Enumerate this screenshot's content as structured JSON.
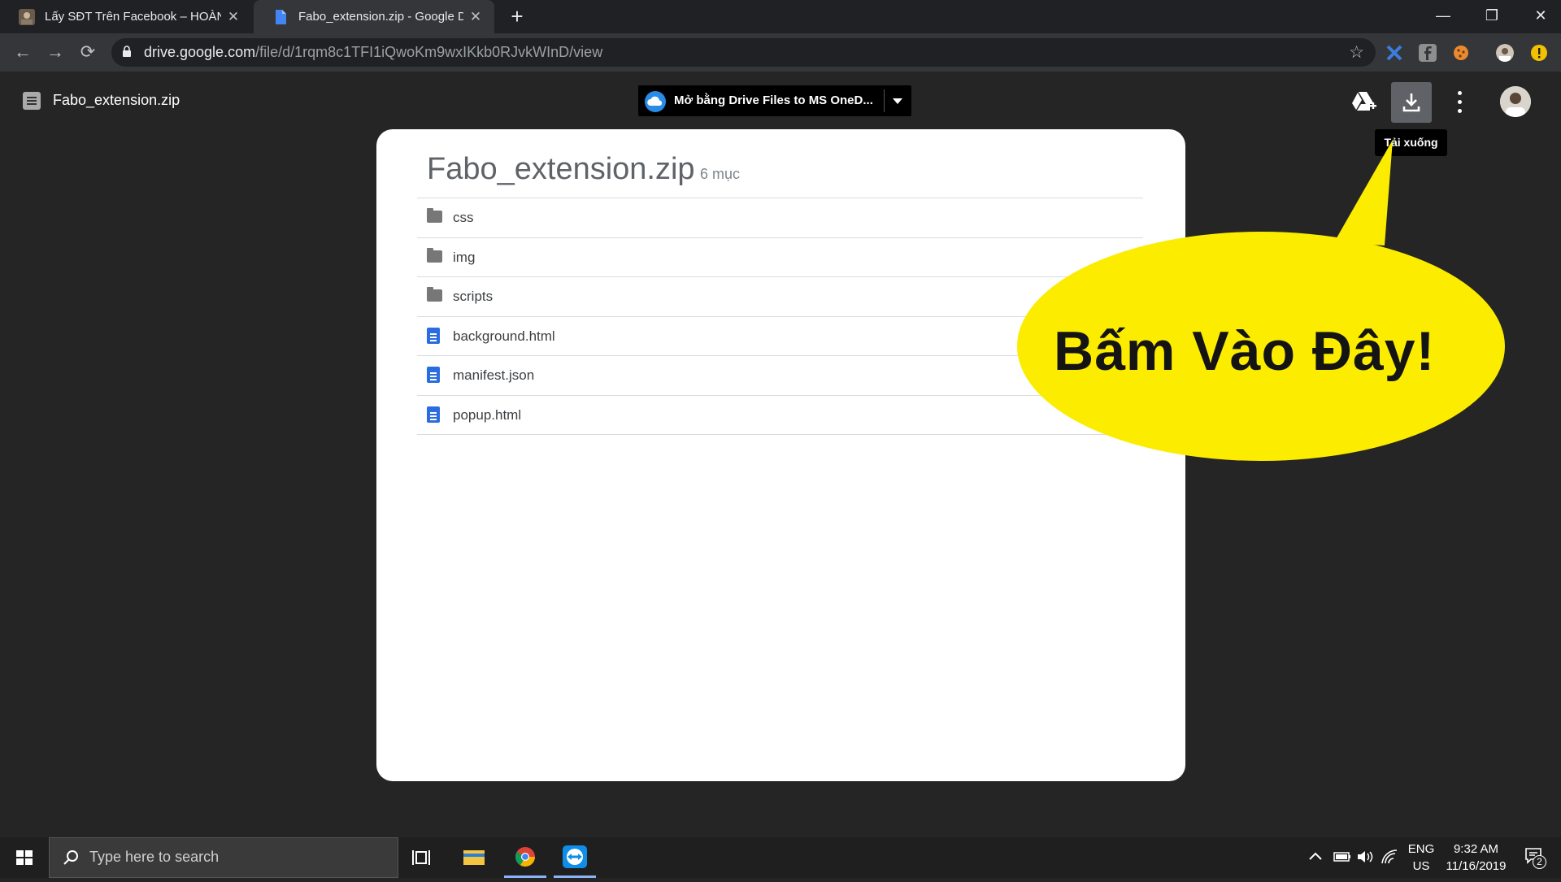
{
  "tabs": [
    {
      "title": "Lấy SĐT Trên Facebook – HOÀNG",
      "active": false
    },
    {
      "title": "Fabo_extension.zip - Google Driv",
      "active": true
    }
  ],
  "address_bar": {
    "domain": "drive.google.com",
    "path": "/file/d/1rqm8c1TFI1iQwoKm9wxIKkb0RJvkWInD/view"
  },
  "viewer": {
    "file_title": "Fabo_extension.zip",
    "open_with_label": "Mở bằng Drive Files to MS OneD...",
    "download_tooltip": "Tải xuống"
  },
  "zip": {
    "title": "Fabo_extension.zip",
    "count_label": "6 mục",
    "items": [
      {
        "name": "css",
        "kind": "folder"
      },
      {
        "name": "img",
        "kind": "folder"
      },
      {
        "name": "scripts",
        "kind": "folder"
      },
      {
        "name": "background.html",
        "kind": "file"
      },
      {
        "name": "manifest.json",
        "kind": "file"
      },
      {
        "name": "popup.html",
        "kind": "file"
      }
    ]
  },
  "callout": {
    "text": "Bấm Vào Đây!",
    "color": "#fcec00"
  },
  "taskbar": {
    "search_placeholder": "Type here to search",
    "lang_top": "ENG",
    "lang_bottom": "US",
    "time": "9:32 AM",
    "date": "11/16/2019",
    "notification_count": "2"
  }
}
